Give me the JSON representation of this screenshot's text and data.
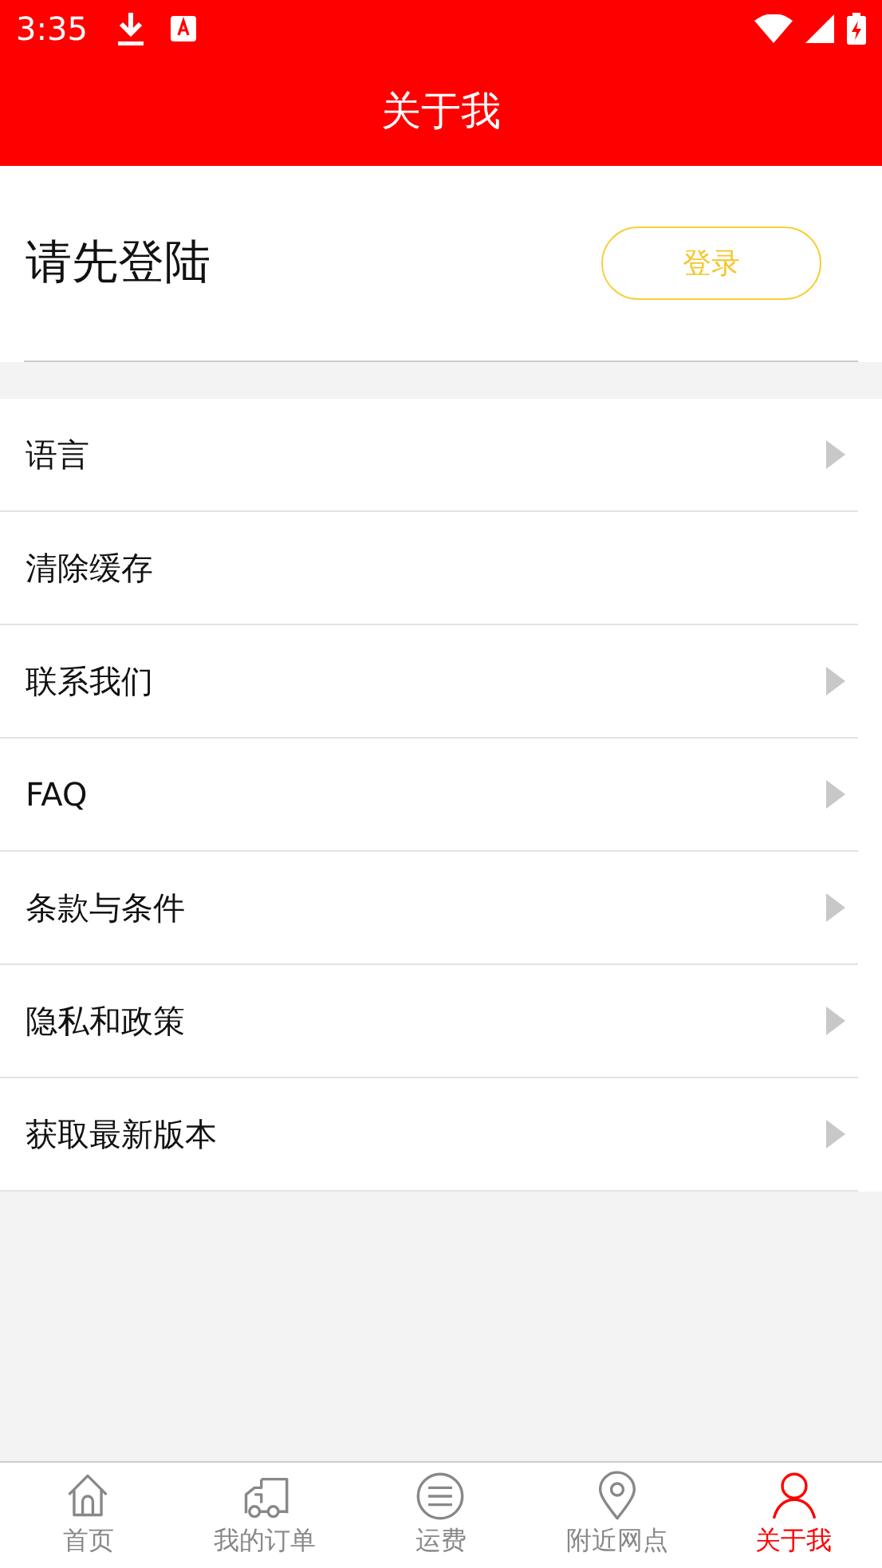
{
  "status_bar": {
    "time": "3:35"
  },
  "header": {
    "title": "关于我"
  },
  "login": {
    "prompt": "请先登陆",
    "button": "登录"
  },
  "menu": [
    {
      "label": "语言",
      "arrow": true
    },
    {
      "label": "清除缓存",
      "arrow": false
    },
    {
      "label": "联系我们",
      "arrow": true
    },
    {
      "label": "FAQ",
      "arrow": true
    },
    {
      "label": "条款与条件",
      "arrow": true
    },
    {
      "label": "隐私和政策",
      "arrow": true
    },
    {
      "label": "获取最新版本",
      "arrow": true
    }
  ],
  "bottom_nav": [
    {
      "label": "首页",
      "selected": false
    },
    {
      "label": "我的订单",
      "selected": false
    },
    {
      "label": "运费",
      "selected": false
    },
    {
      "label": "附近网点",
      "selected": false
    },
    {
      "label": "关于我",
      "selected": true
    }
  ]
}
